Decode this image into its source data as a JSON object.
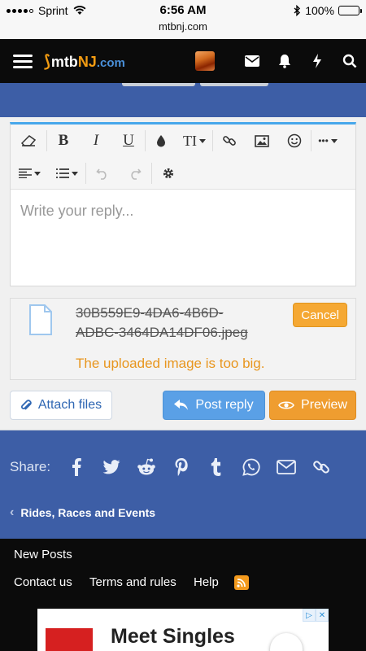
{
  "status_bar": {
    "carrier": "Sprint",
    "time": "6:56 AM",
    "url": "mtbnj.com",
    "battery": "100%",
    "battery_level": 1.0
  },
  "header": {
    "logo_mtb": "mtb",
    "logo_nj": "NJ",
    "logo_com": ".com",
    "icons": [
      "menu-icon",
      "avatar",
      "envelope-icon",
      "bell-icon",
      "lightning-icon",
      "search-icon"
    ]
  },
  "editor": {
    "toolbar_row1": [
      "eraser-icon",
      "bold",
      "italic",
      "underline",
      "color-drop-icon",
      "text-size-icon",
      "link-icon",
      "image-icon",
      "smiley-icon",
      "more-icon"
    ],
    "toolbar_row2": [
      "align-icon",
      "list-icon",
      "undo-icon",
      "redo-icon",
      "gear-icon"
    ],
    "bold": "B",
    "italic": "I",
    "underline": "U",
    "text_size": "TI",
    "more": "•••",
    "placeholder": "Write your reply..."
  },
  "attachment": {
    "filename_line1": "30B559E9-4DA6-4B6D-",
    "filename_line2": "ADBC-3464DA14DF06.jpeg",
    "error": "The uploaded image is too big.",
    "cancel_label": "Cancel"
  },
  "actions": {
    "attach_label": "Attach files",
    "post_label": "Post reply",
    "preview_label": "Preview"
  },
  "share": {
    "label": "Share:",
    "icons": [
      "facebook-icon",
      "twitter-icon",
      "reddit-icon",
      "pinterest-icon",
      "tumblr-icon",
      "whatsapp-icon",
      "email-icon",
      "link-icon"
    ]
  },
  "breadcrumb": {
    "label": "Rides, Races and Events"
  },
  "footer": {
    "new_posts": "New Posts",
    "contact": "Contact us",
    "terms": "Terms and rules",
    "help": "Help"
  },
  "ad": {
    "title": "Meet Singles"
  },
  "colors": {
    "brand_blue": "#3d5ea6",
    "header_black": "#0b0b0b",
    "editor_accent": "#47a7eb",
    "warning_orange": "#e8961e",
    "post_blue": "#5aa0e6",
    "preview_orange": "#ef9d30"
  }
}
